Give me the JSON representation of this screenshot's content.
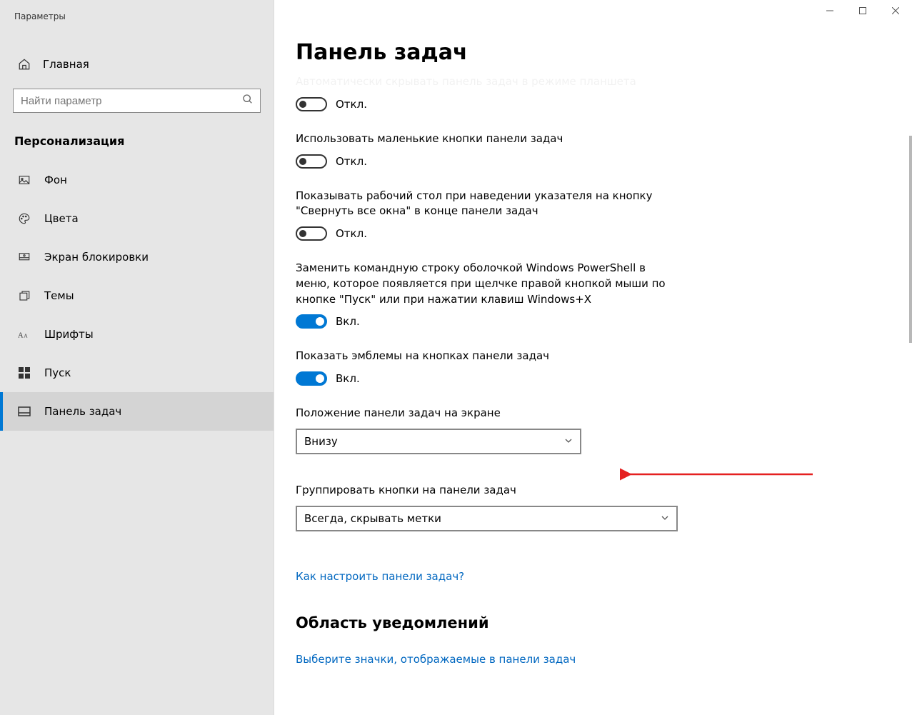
{
  "app": {
    "title": "Параметры"
  },
  "window_controls": {
    "min": "—",
    "max": "▢",
    "close": "✕"
  },
  "sidebar": {
    "home_label": "Главная",
    "search_placeholder": "Найти параметр",
    "group_header": "Персонализация",
    "items": [
      {
        "label": "Фон",
        "icon": "image"
      },
      {
        "label": "Цвета",
        "icon": "palette"
      },
      {
        "label": "Экран блокировки",
        "icon": "lock-screen"
      },
      {
        "label": "Темы",
        "icon": "themes"
      },
      {
        "label": "Шрифты",
        "icon": "fonts"
      },
      {
        "label": "Пуск",
        "icon": "start"
      },
      {
        "label": "Панель задач",
        "icon": "taskbar",
        "active": true
      }
    ]
  },
  "page": {
    "title": "Панель задач",
    "cutoff_setting": "Автоматически скрывать панель задач в режиме планшета",
    "toggle_off": "Откл.",
    "toggle_on": "Вкл.",
    "settings": [
      {
        "label": "",
        "state": "off"
      },
      {
        "label": "Использовать маленькие кнопки панели задач",
        "state": "off"
      },
      {
        "label": "Показывать рабочий стол при наведении указателя на кнопку \"Свернуть все окна\" в конце панели задач",
        "state": "off"
      },
      {
        "label": "Заменить командную строку оболочкой Windows PowerShell в меню, которое появляется при щелчке правой кнопкой мыши по кнопке \"Пуск\" или при нажатии клавиш Windows+X",
        "state": "on"
      },
      {
        "label": "Показать эмблемы на кнопках панели задач",
        "state": "on"
      }
    ],
    "select_position": {
      "label": "Положение панели задач на экране",
      "value": "Внизу"
    },
    "select_combine": {
      "label": "Группировать кнопки на панели задач",
      "value": "Всегда, скрывать метки"
    },
    "link_howto": "Как настроить панели задач?",
    "section_notification": {
      "header": "Область уведомлений",
      "link": "Выберите значки, отображаемые в панели задач"
    }
  }
}
